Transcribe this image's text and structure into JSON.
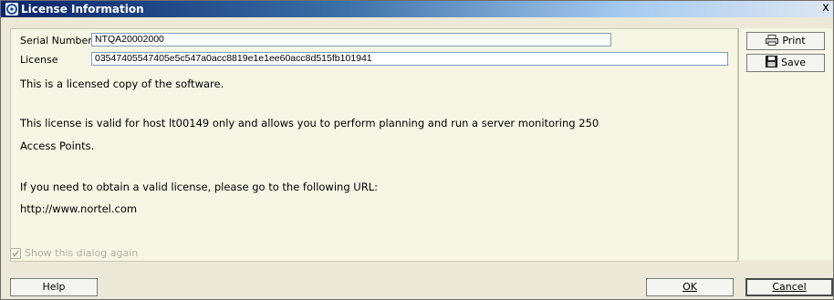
{
  "window": {
    "title": "License Information",
    "close_glyph": "x"
  },
  "fields": {
    "serial_label": "Serial Number",
    "serial_value": "NTQA20002000",
    "license_label": "License",
    "license_value": "03547405547405e5c547a0acc8819e1e1ee60acc8d515fb101941"
  },
  "message": {
    "line1": "This is a licensed copy of the software.",
    "line2": "This license is valid for host lt00149 only and allows you to perform planning and run a server monitoring 250",
    "line3": "Access Points.",
    "line4": "If you need to obtain a valid license, please go to the following URL:",
    "line5": "http://www.nortel.com"
  },
  "checkbox": {
    "label": "Show this dialog again",
    "checked": true,
    "enabled": false
  },
  "side_buttons": {
    "print_label": "Print",
    "save_label": "Save"
  },
  "bottom_buttons": {
    "help_label": "Help",
    "ok_label": "OK",
    "cancel_label": "Cancel"
  },
  "icons": {
    "app": "app-logo-icon",
    "print": "printer-icon",
    "save": "floppy-disk-icon",
    "check": "checkmark-icon"
  }
}
